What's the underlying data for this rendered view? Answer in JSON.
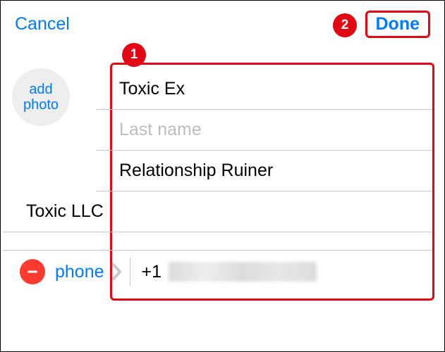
{
  "header": {
    "cancel_label": "Cancel",
    "done_label": "Done"
  },
  "avatar": {
    "line1": "add",
    "line2": "photo"
  },
  "fields": {
    "first_name": "Toxic Ex",
    "last_name_placeholder": "Last name",
    "nickname": "Relationship Ruiner",
    "company": "Toxic LLC"
  },
  "phone": {
    "label": "phone",
    "prefix": "+1"
  },
  "callouts": {
    "c1": "1",
    "c2": "2"
  }
}
